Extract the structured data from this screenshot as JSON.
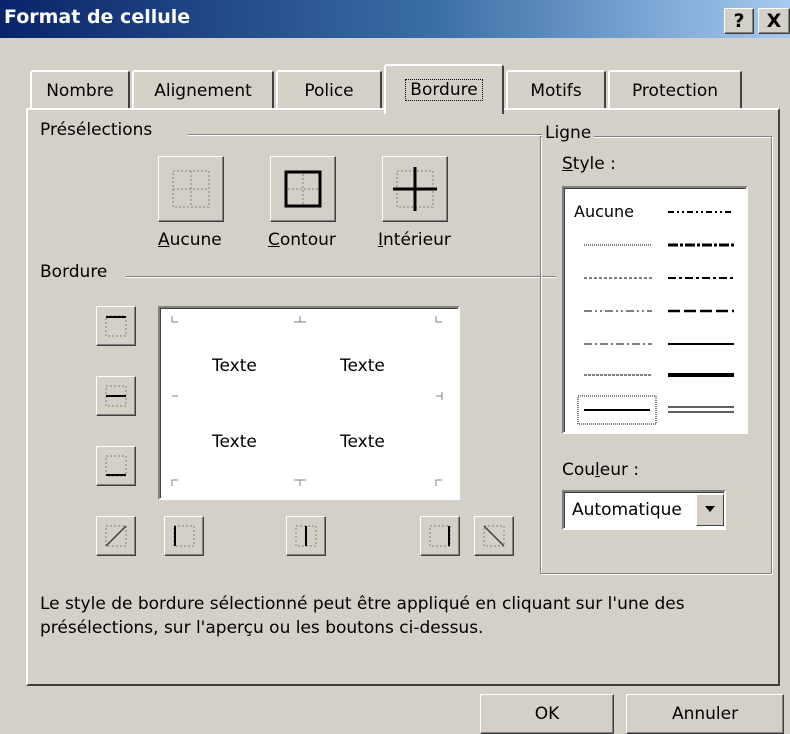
{
  "window": {
    "title": "Format de cellule",
    "help": "?",
    "close": "X"
  },
  "tabs": [
    "Nombre",
    "Alignement",
    "Police",
    "Bordure",
    "Motifs",
    "Protection"
  ],
  "presets": {
    "group_label": "Présélections",
    "none": {
      "u": "A",
      "rest": "ucune"
    },
    "outline": {
      "u": "C",
      "rest": "ontour"
    },
    "inside": {
      "u": "I",
      "rest": "ntérieur"
    }
  },
  "border": {
    "group_label": "Bordure",
    "preview_text": [
      "Texte",
      "Texte",
      "Texte",
      "Texte"
    ]
  },
  "line": {
    "group_label": "Ligne",
    "style_label": {
      "u": "S",
      "rest": "tyle :"
    },
    "none_label": "Aucune",
    "color_label": {
      "pre": "Cou",
      "u": "l",
      "rest": "eur :"
    },
    "color_value": "Automatique"
  },
  "help_text": [
    "Le style de bordure sélectionné peut être appliqué en cliquant sur l'une des",
    "présélections, sur l'aperçu ou les boutons ci-dessus."
  ],
  "buttons": {
    "ok": "OK",
    "cancel": "Annuler"
  },
  "colors": {
    "titlebar_start": "#0a246a",
    "titlebar_end": "#a6caf0",
    "face": "#d4d0c8"
  }
}
